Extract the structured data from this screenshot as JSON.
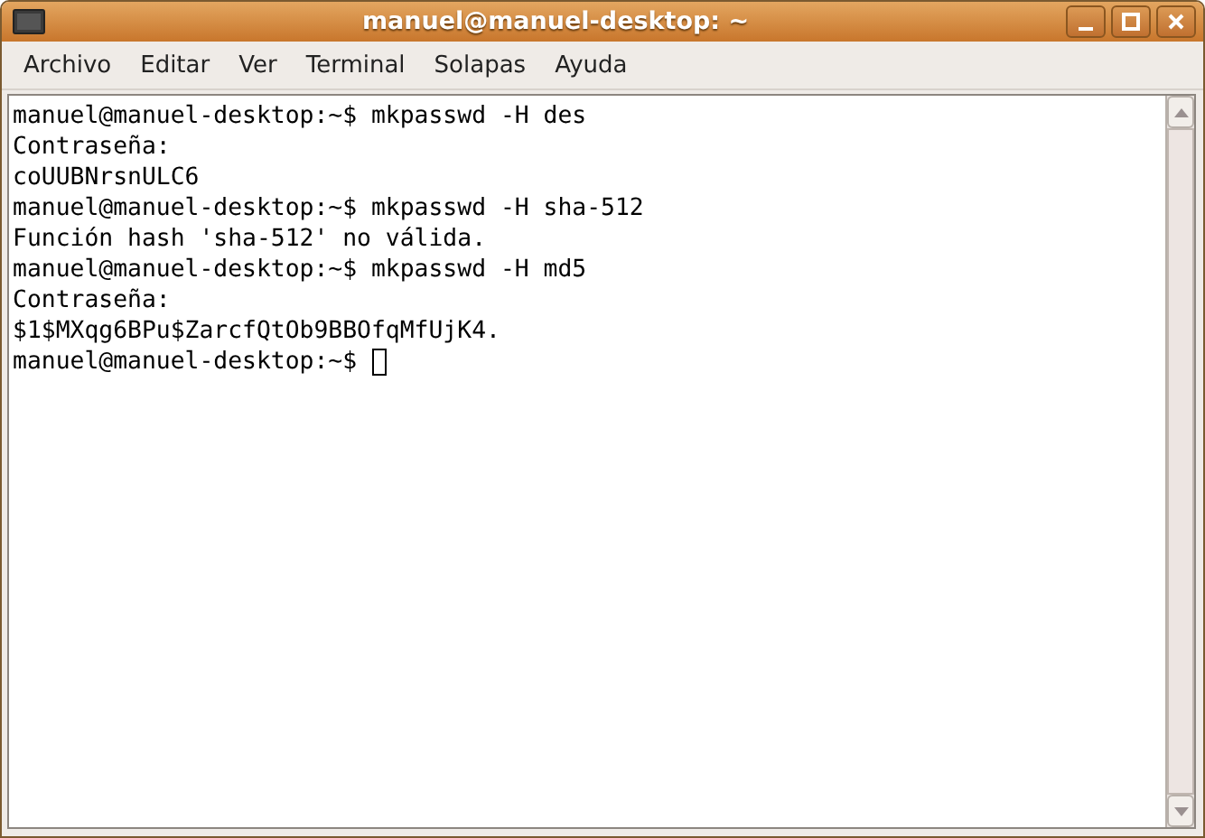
{
  "window": {
    "title": "manuel@manuel-desktop: ~"
  },
  "menu": [
    {
      "label": "Archivo"
    },
    {
      "label": "Editar"
    },
    {
      "label": "Ver"
    },
    {
      "label": "Terminal"
    },
    {
      "label": "Solapas"
    },
    {
      "label": "Ayuda"
    }
  ],
  "terminal": {
    "lines": [
      "manuel@manuel-desktop:~$ mkpasswd -H des",
      "Contraseña:",
      "coUUBNrsnULC6",
      "manuel@manuel-desktop:~$ mkpasswd -H sha-512",
      "Función hash 'sha-512' no válida.",
      "manuel@manuel-desktop:~$ mkpasswd -H md5",
      "Contraseña:",
      "$1$MXqg6BPu$ZarcfQtOb9BBOfqMfUjK4."
    ],
    "prompt": "manuel@manuel-desktop:~$"
  }
}
